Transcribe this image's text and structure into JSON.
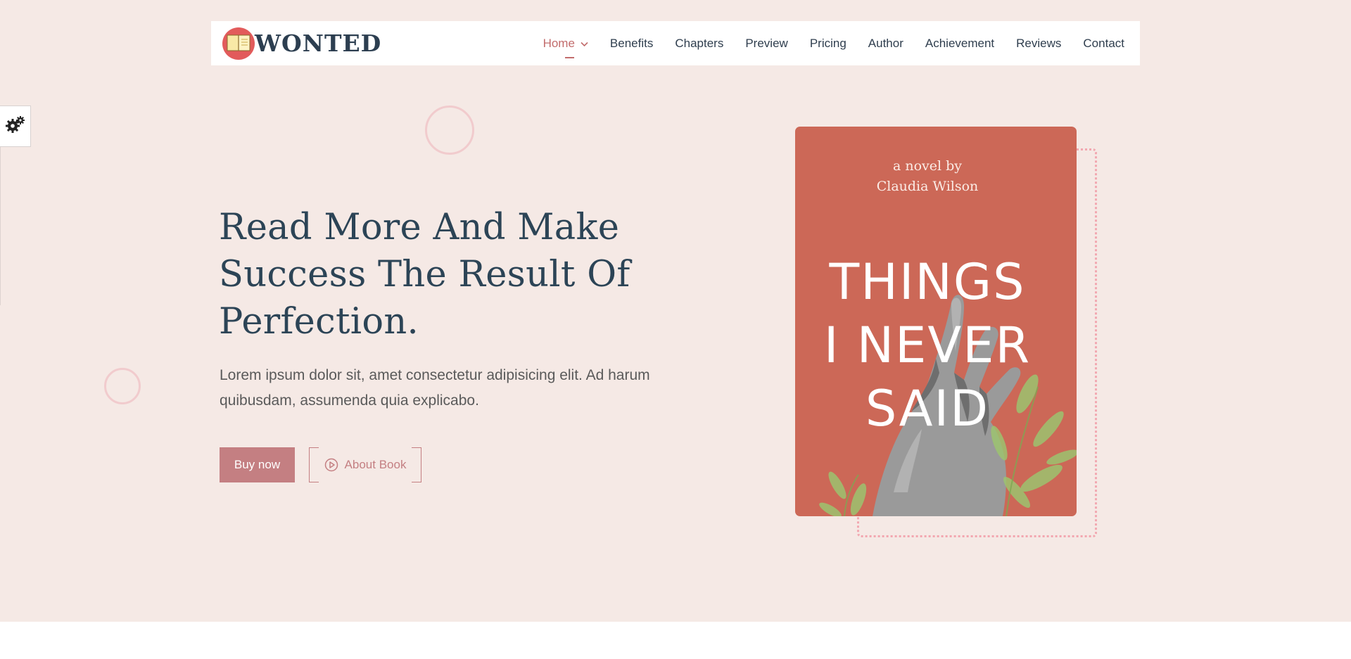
{
  "brand": {
    "name": "WONTED"
  },
  "nav": {
    "items": [
      {
        "label": "Home",
        "active": true
      },
      {
        "label": "Benefits"
      },
      {
        "label": "Chapters"
      },
      {
        "label": "Preview"
      },
      {
        "label": "Pricing"
      },
      {
        "label": "Author"
      },
      {
        "label": "Achievement"
      },
      {
        "label": "Reviews"
      },
      {
        "label": "Contact"
      }
    ]
  },
  "hero": {
    "headline": "Read More And Make Success The Result Of Perfection.",
    "lead": "Lorem ipsum dolor sit, amet consectetur adipisicing elit. Ad harum quibusdam, assumenda quia explicabo.",
    "buy_label": "Buy now",
    "about_label": "About Book"
  },
  "book": {
    "byline_1": "a novel by",
    "byline_2": "Claudia Wilson",
    "title_1": "THINGS",
    "title_2": "I NEVER",
    "title_3": "SAID"
  },
  "colors": {
    "hero_bg": "#f5e9e5",
    "accent": "#c47f82",
    "heading": "#2c4456",
    "book_cover": "#cc6857"
  },
  "icons": {
    "logo": "book-icon",
    "settings": "gear-icon",
    "nav_dropdown": "chevron-down-icon",
    "about_button": "play-circle-icon"
  }
}
